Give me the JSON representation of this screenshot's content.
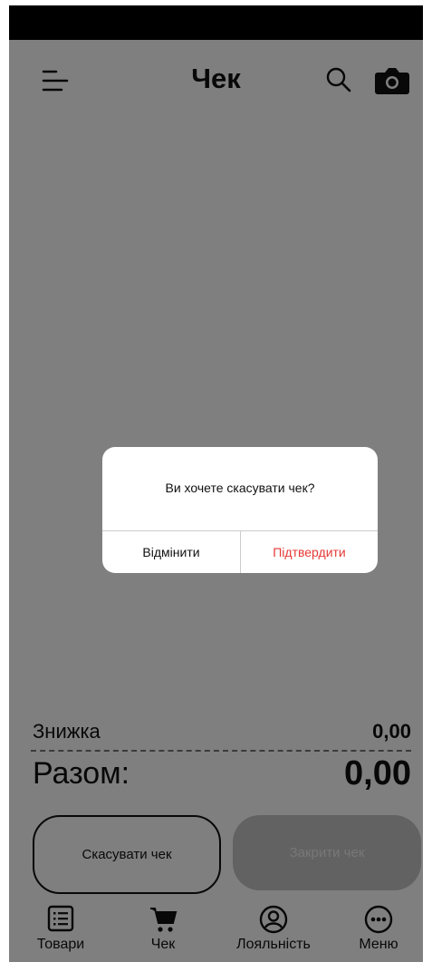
{
  "header": {
    "title": "Чек",
    "menu_icon": "hamburger-menu-icon",
    "search_icon": "search-icon",
    "camera_icon": "camera-icon"
  },
  "summary": {
    "discount_label": "Знижка",
    "discount_value": "0,00",
    "total_label": "Разом:",
    "total_value": "0,00"
  },
  "actions": {
    "cancel_label": "Скасувати чек",
    "close_label": "Закрити чек"
  },
  "tabbar": {
    "items": [
      {
        "label": "Товари",
        "icon": "list-icon"
      },
      {
        "label": "Чек",
        "icon": "cart-icon"
      },
      {
        "label": "Лояльність",
        "icon": "user-circle-icon"
      },
      {
        "label": "Меню",
        "icon": "more-dots-icon"
      }
    ]
  },
  "dialog": {
    "message": "Ви хочете скасувати чек?",
    "cancel_label": "Відмінити",
    "confirm_label": "Підтвердити"
  },
  "colors": {
    "overlay": "#000000",
    "confirm": "#e53935",
    "disabled_button": "#c4c4c4"
  }
}
